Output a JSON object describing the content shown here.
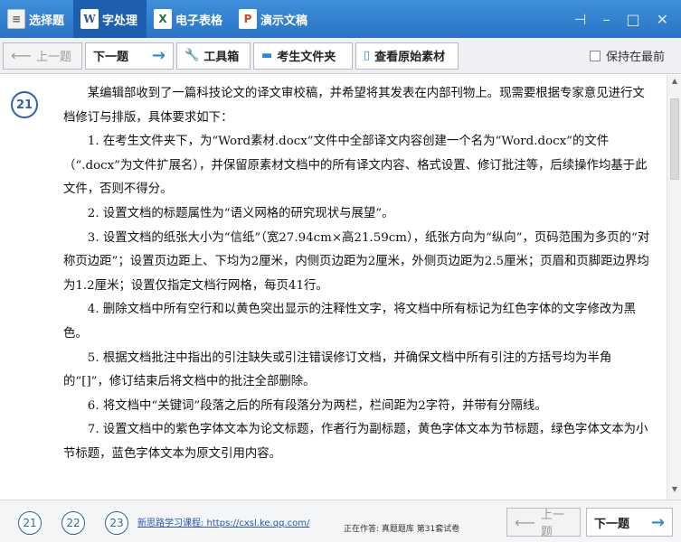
{
  "titlebar": {
    "tabs": [
      {
        "label": "选择题",
        "icon": "document-icon"
      },
      {
        "label": "字处理",
        "icon": "word-icon",
        "active": true
      },
      {
        "label": "电子表格",
        "icon": "excel-icon"
      },
      {
        "label": "演示文稿",
        "icon": "ppt-icon"
      }
    ],
    "controls": [
      "pin-icon",
      "minimize-icon",
      "maximize-icon",
      "close-icon"
    ]
  },
  "toolbar": {
    "prev_label": "上一题",
    "next_label": "下一题",
    "toolbox_label": "工具箱",
    "examinee_folder_label": "考生文件夹",
    "view_source_label": "查看原始素材",
    "keep_on_top_label": "保持在最前"
  },
  "question": {
    "number": "21",
    "paragraphs": [
      "某编辑部收到了一篇科技论文的译文审校稿，并希望将其发表在内部刊物上。现需要根据专家意见进行文档修订与排版，具体要求如下：",
      "1. 在考生文件夹下，为“Word素材.docx”文件中全部译文内容创建一个名为“Word.docx”的文件（“.docx”为文件扩展名），并保留原素材文档中的所有译文内容、格式设置、修订批注等，后续操作均基于此文件，否则不得分。",
      "2. 设置文档的标题属性为“语义网格的研究现状与展望”。",
      "3. 设置文档的纸张大小为“信纸”（宽27.94cm×高21.59cm），纸张方向为“纵向”，页码范围为多页的“对称页边距”；设置页边距上、下均为2厘米，内侧页边距为2厘米，外侧页边距为2.5厘米；页眉和页脚距边界均为1.2厘米；设置仅指定文档行网格，每页41行。",
      "4. 删除文档中所有空行和以黄色突出显示的注释性文字，将文档中所有标记为红色字体的文字修改为黑色。",
      "5. 根据文档批注中指出的引注缺失或引注错误修订文档，并确保文档中所有引注的方括号均为半角的“[]”，修订结束后将文档中的批注全部删除。",
      "6. 将文档中“关键词”段落之后的所有段落分为两栏，栏间距为2字符，并带有分隔线。",
      "7. 设置文档中的紫色字体文本为论文标题，作者行为副标题，黄色字体文本为节标题，绿色字体文本为小节标题，蓝色字体文本为原文引用内容。"
    ]
  },
  "footer": {
    "numbers": [
      "21",
      "22",
      "23"
    ],
    "link": "新思路学习课程: https://cxsl.ke.qq.com/",
    "note": "正在作答: 真题题库 第31套试卷",
    "prev_label": "上一题",
    "next_label": "下一题"
  },
  "colors": {
    "titlebar": "#2a74c6",
    "accent": "#2b8ad8",
    "circle": "#2f62a8"
  }
}
